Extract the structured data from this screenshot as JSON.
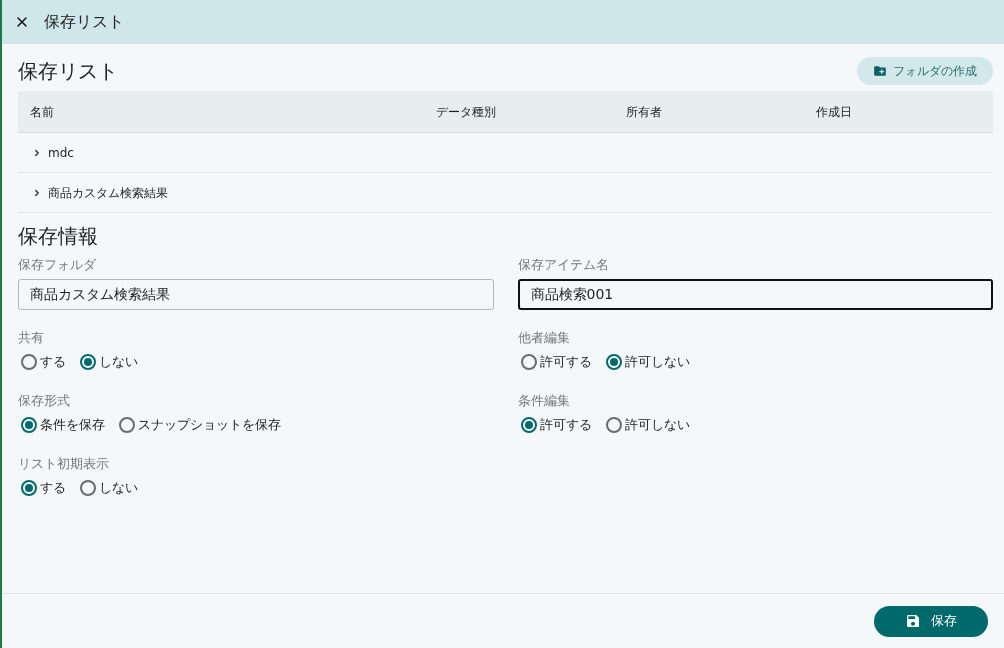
{
  "dialog": {
    "title": "保存リスト"
  },
  "list_section": {
    "heading": "保存リスト",
    "create_folder_button": "フォルダの作成",
    "table": {
      "columns": [
        "名前",
        "データ種別",
        "所有者",
        "作成日"
      ],
      "rows": [
        {
          "name": "mdc",
          "expanded": false
        },
        {
          "name": "商品カスタム検索結果",
          "expanded": false
        }
      ]
    }
  },
  "info_section": {
    "heading": "保存情報",
    "text_fields": [
      {
        "label": "保存フォルダ",
        "value": "商品カスタム検索結果",
        "focused": false
      },
      {
        "label": "保存アイテム名",
        "value": "商品検索001",
        "focused": true
      }
    ],
    "radio_groups": [
      {
        "label": "共有",
        "options": [
          {
            "label": "する",
            "selected": false
          },
          {
            "label": "しない",
            "selected": true
          }
        ]
      },
      {
        "label": "他者編集",
        "options": [
          {
            "label": "許可する",
            "selected": false
          },
          {
            "label": "許可しない",
            "selected": true
          }
        ]
      },
      {
        "label": "保存形式",
        "options": [
          {
            "label": "条件を保存",
            "selected": true
          },
          {
            "label": "スナップショットを保存",
            "selected": false
          }
        ]
      },
      {
        "label": "条件編集",
        "options": [
          {
            "label": "許可する",
            "selected": true
          },
          {
            "label": "許可しない",
            "selected": false
          }
        ]
      },
      {
        "label": "リスト初期表示",
        "options": [
          {
            "label": "する",
            "selected": true
          },
          {
            "label": "しない",
            "selected": false
          }
        ]
      }
    ]
  },
  "footer": {
    "save_button": "保存"
  }
}
